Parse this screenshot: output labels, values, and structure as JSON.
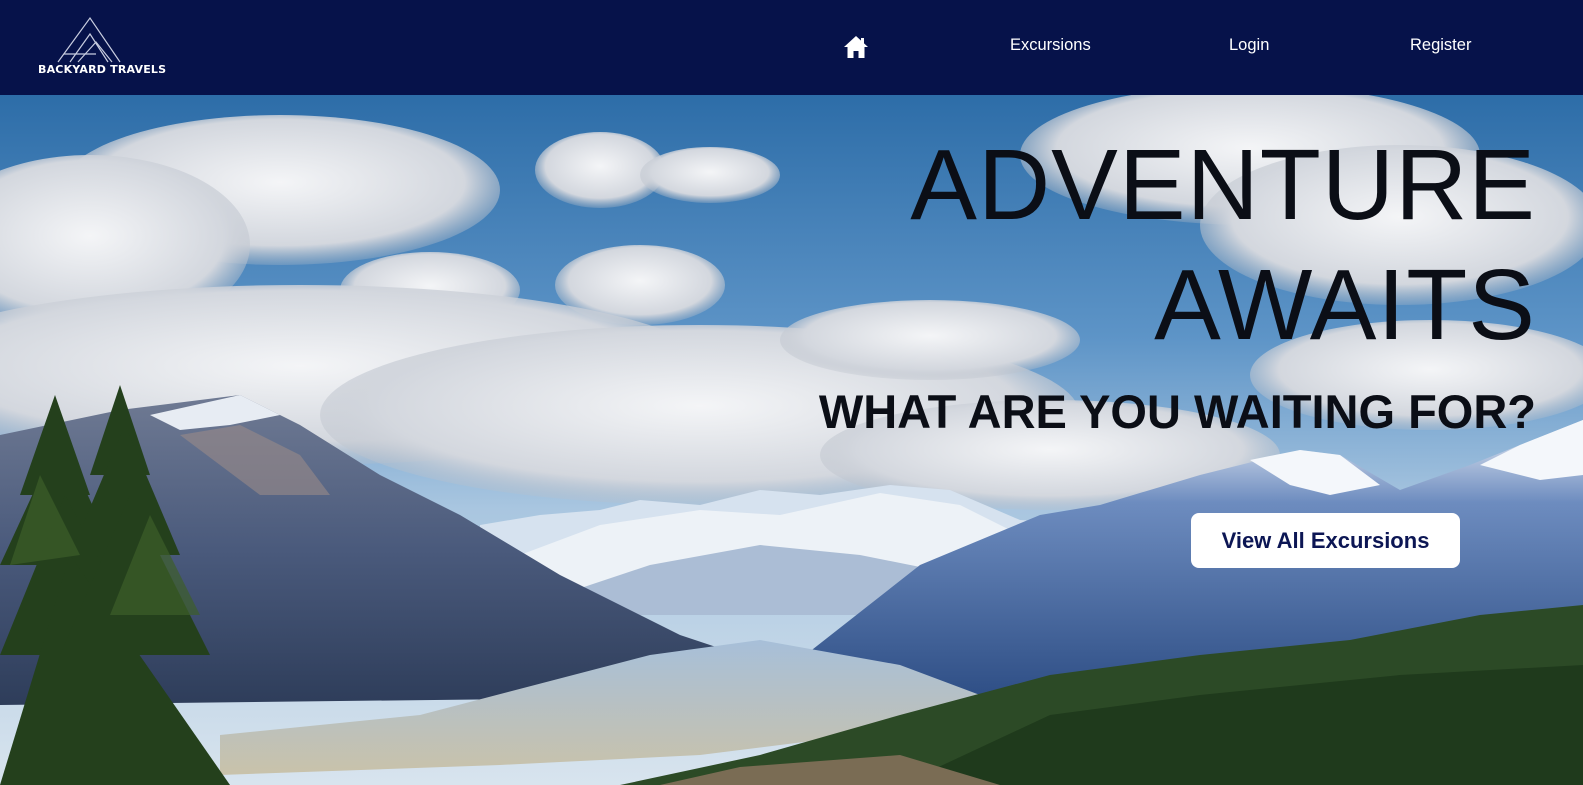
{
  "brand": {
    "name": "BACKYARD TRAVELS",
    "color": "#06124a"
  },
  "nav": {
    "home_icon": "home-icon",
    "items": [
      {
        "label": "Excursions"
      },
      {
        "label": "Login"
      },
      {
        "label": "Register"
      }
    ]
  },
  "hero": {
    "headline_line1": "ADVENTURE",
    "headline_line2": "AWAITS",
    "subheadline": "WHAT ARE YOU WAITING FOR?",
    "cta_label": "View All Excursions",
    "background": "mountain-valley-landscape"
  }
}
